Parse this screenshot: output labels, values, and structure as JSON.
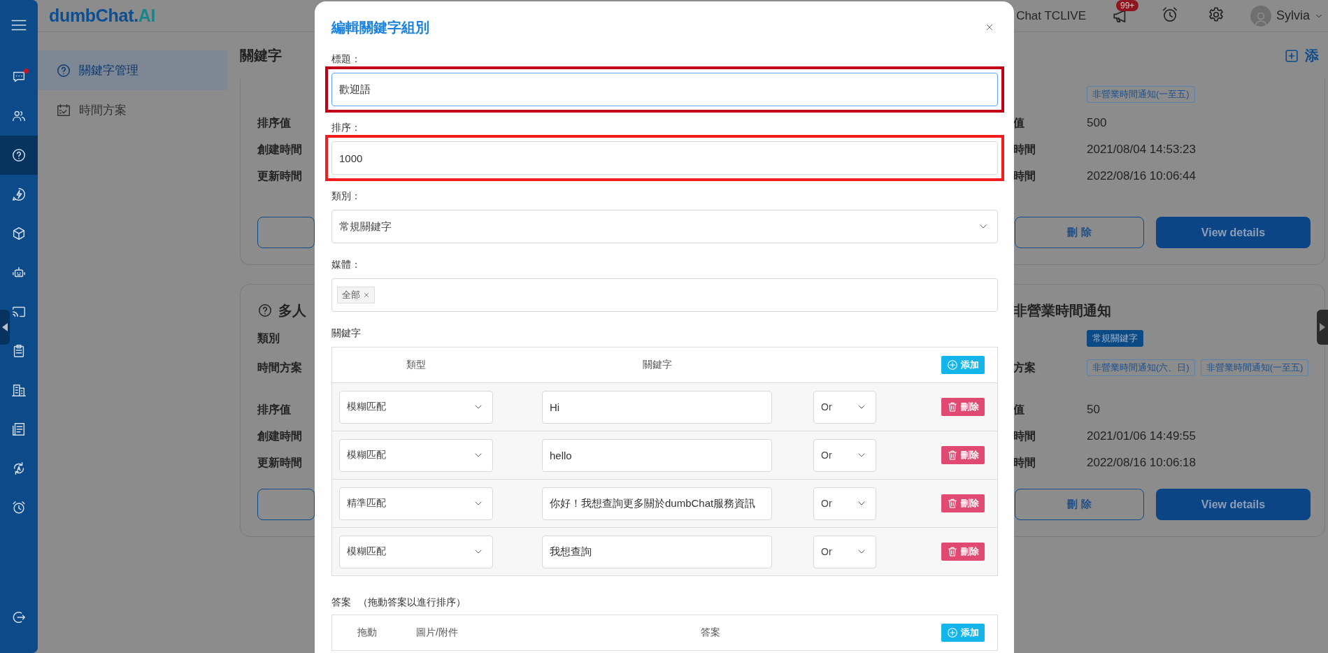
{
  "rail": {
    "items": [
      {
        "kind": "chat",
        "dot": true,
        "selected": false
      },
      {
        "kind": "users",
        "dot": false,
        "selected": false
      },
      {
        "kind": "help",
        "dot": false,
        "selected": true
      },
      {
        "kind": "flash",
        "dot": false,
        "selected": false
      },
      {
        "kind": "cube",
        "dot": false,
        "selected": false
      },
      {
        "kind": "robot",
        "dot": false,
        "selected": false
      },
      {
        "kind": "cast",
        "dot": false,
        "selected": false
      },
      {
        "kind": "clipboard",
        "dot": false,
        "selected": false
      },
      {
        "kind": "building",
        "dot": false,
        "selected": false
      },
      {
        "kind": "document",
        "dot": false,
        "selected": false
      },
      {
        "kind": "translate",
        "dot": false,
        "selected": false
      },
      {
        "kind": "alarm",
        "dot": false,
        "selected": false
      },
      {
        "kind": "logout",
        "dot": false,
        "selected": false
      }
    ]
  },
  "header": {
    "logo": {
      "text": "dumbChat.",
      "accent": "AI"
    },
    "workspace": "Chat TCLIVE",
    "badge": "99+",
    "user": "Sylvia"
  },
  "subnav": {
    "items": [
      {
        "kind": "help",
        "label": "關鍵字管理",
        "selected": true
      },
      {
        "kind": "calendar",
        "label": "時間方案",
        "selected": false
      }
    ]
  },
  "content": {
    "heading": "關鍵字",
    "add": "添",
    "cards": [
      {
        "rows": [
          {
            "kind": "tags"
          },
          {
            "kind": "text",
            "label": "排序值"
          },
          {
            "kind": "text",
            "label": "創建時間"
          },
          {
            "kind": "text",
            "label": "更新時間"
          }
        ],
        "buttons": [
          {
            "kind": "outline"
          }
        ]
      },
      {
        "title": "多人",
        "title_icon": true,
        "rows": [
          {
            "kind": "badge",
            "label": "類別"
          },
          {
            "kind": "tags",
            "label": "時間方案"
          },
          {
            "kind": "text",
            "label": "排序值"
          },
          {
            "kind": "text",
            "label": "創建時間"
          },
          {
            "kind": "text",
            "label": "更新時間"
          }
        ],
        "buttons": [
          {
            "kind": "outline"
          }
        ]
      },
      {
        "rows": [
          {
            "kind": "tags",
            "tags": [
              "非營業時間通知(一至五)"
            ]
          },
          {
            "kind": "text",
            "label": "值",
            "value": "500"
          },
          {
            "kind": "text",
            "label": "時間",
            "value": "2021/08/04 14:53:23"
          },
          {
            "kind": "text",
            "label": "時間",
            "value": "2022/08/16 10:06:44"
          }
        ],
        "buttons": [
          {
            "kind": "outline",
            "label": "刪 除"
          },
          {
            "kind": "solid",
            "label": "View details"
          }
        ]
      },
      {
        "title": "非營業時間通知",
        "title_icon": false,
        "rows": [
          {
            "kind": "badge",
            "badge": "常規關鍵字"
          },
          {
            "kind": "tags",
            "label": "方案",
            "tags": [
              "非營業時間通知(六、日)",
              "非營業時間通知(一至五)"
            ]
          },
          {
            "kind": "text",
            "label": "值",
            "value": "50"
          },
          {
            "kind": "text",
            "label": "時間",
            "value": "2021/01/06 14:49:55"
          },
          {
            "kind": "text",
            "label": "時間",
            "value": "2022/08/16 10:06:18"
          }
        ],
        "buttons": [
          {
            "kind": "outline",
            "label": "刪 除"
          },
          {
            "kind": "solid",
            "label": "View details"
          }
        ]
      }
    ]
  },
  "modal": {
    "title": "編輯關鍵字組別",
    "fields": [
      {
        "kind": "text",
        "label": "標題：",
        "value": "歡迎語",
        "focused": true,
        "annotation": {
          "color": "#c10018"
        }
      },
      {
        "kind": "text",
        "label": "排序：",
        "value": "1000",
        "focused": false,
        "annotation": {
          "color": "#f41c1c"
        }
      },
      {
        "kind": "select",
        "label": "類別：",
        "value": "常規關鍵字"
      },
      {
        "kind": "tags",
        "label": "媒體：",
        "tags": [
          "全部"
        ]
      }
    ],
    "keywords": {
      "label": "關鍵字",
      "columns": [
        "類型",
        "關鍵字"
      ],
      "add": "添加",
      "rows": [
        {
          "match": "模糊匹配",
          "keyword": "Hi",
          "logic": "Or",
          "delete": "刪除"
        },
        {
          "match": "模糊匹配",
          "keyword": "hello",
          "logic": "Or",
          "delete": "刪除"
        },
        {
          "match": "精準匹配",
          "keyword": "你好！我想查詢更多關於dumbChat服務資訊",
          "logic": "Or",
          "delete": "刪除"
        },
        {
          "match": "模糊匹配",
          "keyword": "我想查詢",
          "logic": "Or",
          "delete": "刪除"
        }
      ]
    },
    "answers": {
      "label": "答案",
      "hint": "（拖動答案以進行排序）",
      "columns": [
        "拖動",
        "圖片/附件",
        "答案"
      ],
      "add": "添加"
    }
  }
}
